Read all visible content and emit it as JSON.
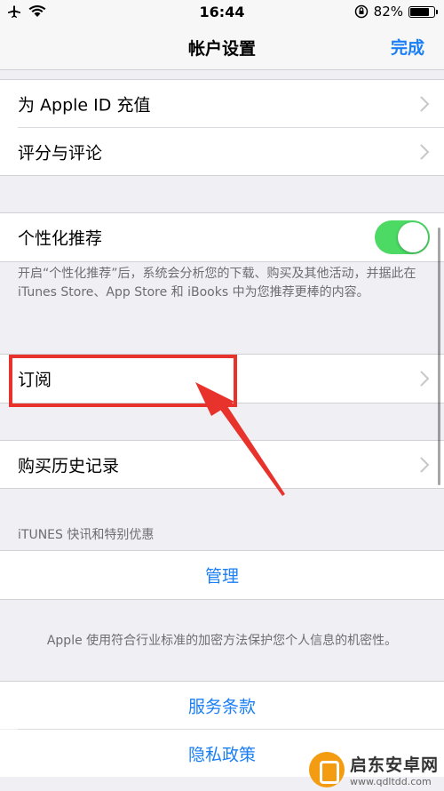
{
  "status_bar": {
    "time": "16:44",
    "battery_percent_text": "82%",
    "battery_level": 0.82,
    "icons": [
      "airplane-icon",
      "wifi-icon",
      "orientation-lock-icon",
      "battery-icon"
    ]
  },
  "nav": {
    "title": "帐户设置",
    "done_label": "完成"
  },
  "group1": {
    "items": [
      {
        "label": "为 Apple ID 充值"
      },
      {
        "label": "评分与评论"
      }
    ]
  },
  "personalized": {
    "label": "个性化推荐",
    "toggle_on": true,
    "footer": "开启“个性化推荐”后，系统会分析您的下载、购买及其他活动，并据此在 iTunes Store、App Store 和 iBooks 中为您推荐更棒的内容。"
  },
  "subscriptions": {
    "label": "订阅"
  },
  "purchase_history": {
    "label": "购买历史记录"
  },
  "itunes_section": {
    "header": "iTUNES 快讯和特别优惠",
    "manage_label": "管理"
  },
  "privacy_footer": "Apple 使用符合行业标准的加密方法保护您个人信息的机密性。",
  "links": {
    "terms": "服务条款",
    "privacy": "隐私政策"
  },
  "watermark": {
    "title": "启东安卓网",
    "url": "www.qdltdd.com"
  },
  "colors": {
    "accent": "#1a7ef5",
    "toggle_on": "#4cd964",
    "annotation_red": "#e8322c",
    "background": "#efeff4"
  }
}
